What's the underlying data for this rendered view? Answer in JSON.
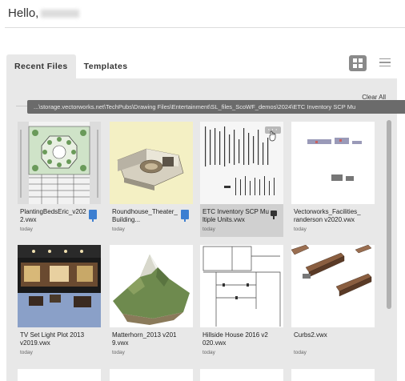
{
  "header": {
    "greeting": "Hello,"
  },
  "tabs": [
    {
      "label": "Recent Files",
      "active": true
    },
    {
      "label": "Templates",
      "active": false
    }
  ],
  "view": {
    "grid_icon": "grid-view-icon",
    "list_icon": "list-view-icon",
    "selected": "grid"
  },
  "panel": {
    "clear_all": "Clear All",
    "tooltip": "...\\storage.vectorworks.net\\TechPubs\\Drawing Files\\Entertainment\\SL_files_ScoWF_demos\\2024\\ETC Inventory SCP Mu"
  },
  "files": [
    {
      "name": "PlantingBedsEric_v2022.vwx",
      "date": "today",
      "status_icon": "cloud-sync-icon"
    },
    {
      "name": "Roundhouse_Theater_Building...",
      "date": "today",
      "status_icon": "cloud-sync-icon"
    },
    {
      "name": "ETC Inventory SCP Multiple Units.vwx",
      "date": "today",
      "status_icon": "pin-icon"
    },
    {
      "name": "Vectorworks_Facilities_randerson v2020.vwx",
      "date": "today",
      "status_icon": ""
    },
    {
      "name": "TV Set Light Plot 2013 v2019.vwx",
      "date": "today",
      "status_icon": ""
    },
    {
      "name": "Matterhorn_2013 v2019.vwx",
      "date": "today",
      "status_icon": ""
    },
    {
      "name": "Hillside House 2016 v2020.vwx",
      "date": "today",
      "status_icon": ""
    },
    {
      "name": "Curbs2.vwx",
      "date": "today",
      "status_icon": ""
    }
  ],
  "colors": {
    "panel_bg": "#e8e8e8",
    "accent_blue": "#3c7fd1",
    "tooltip_bg": "#6b6b6b"
  }
}
